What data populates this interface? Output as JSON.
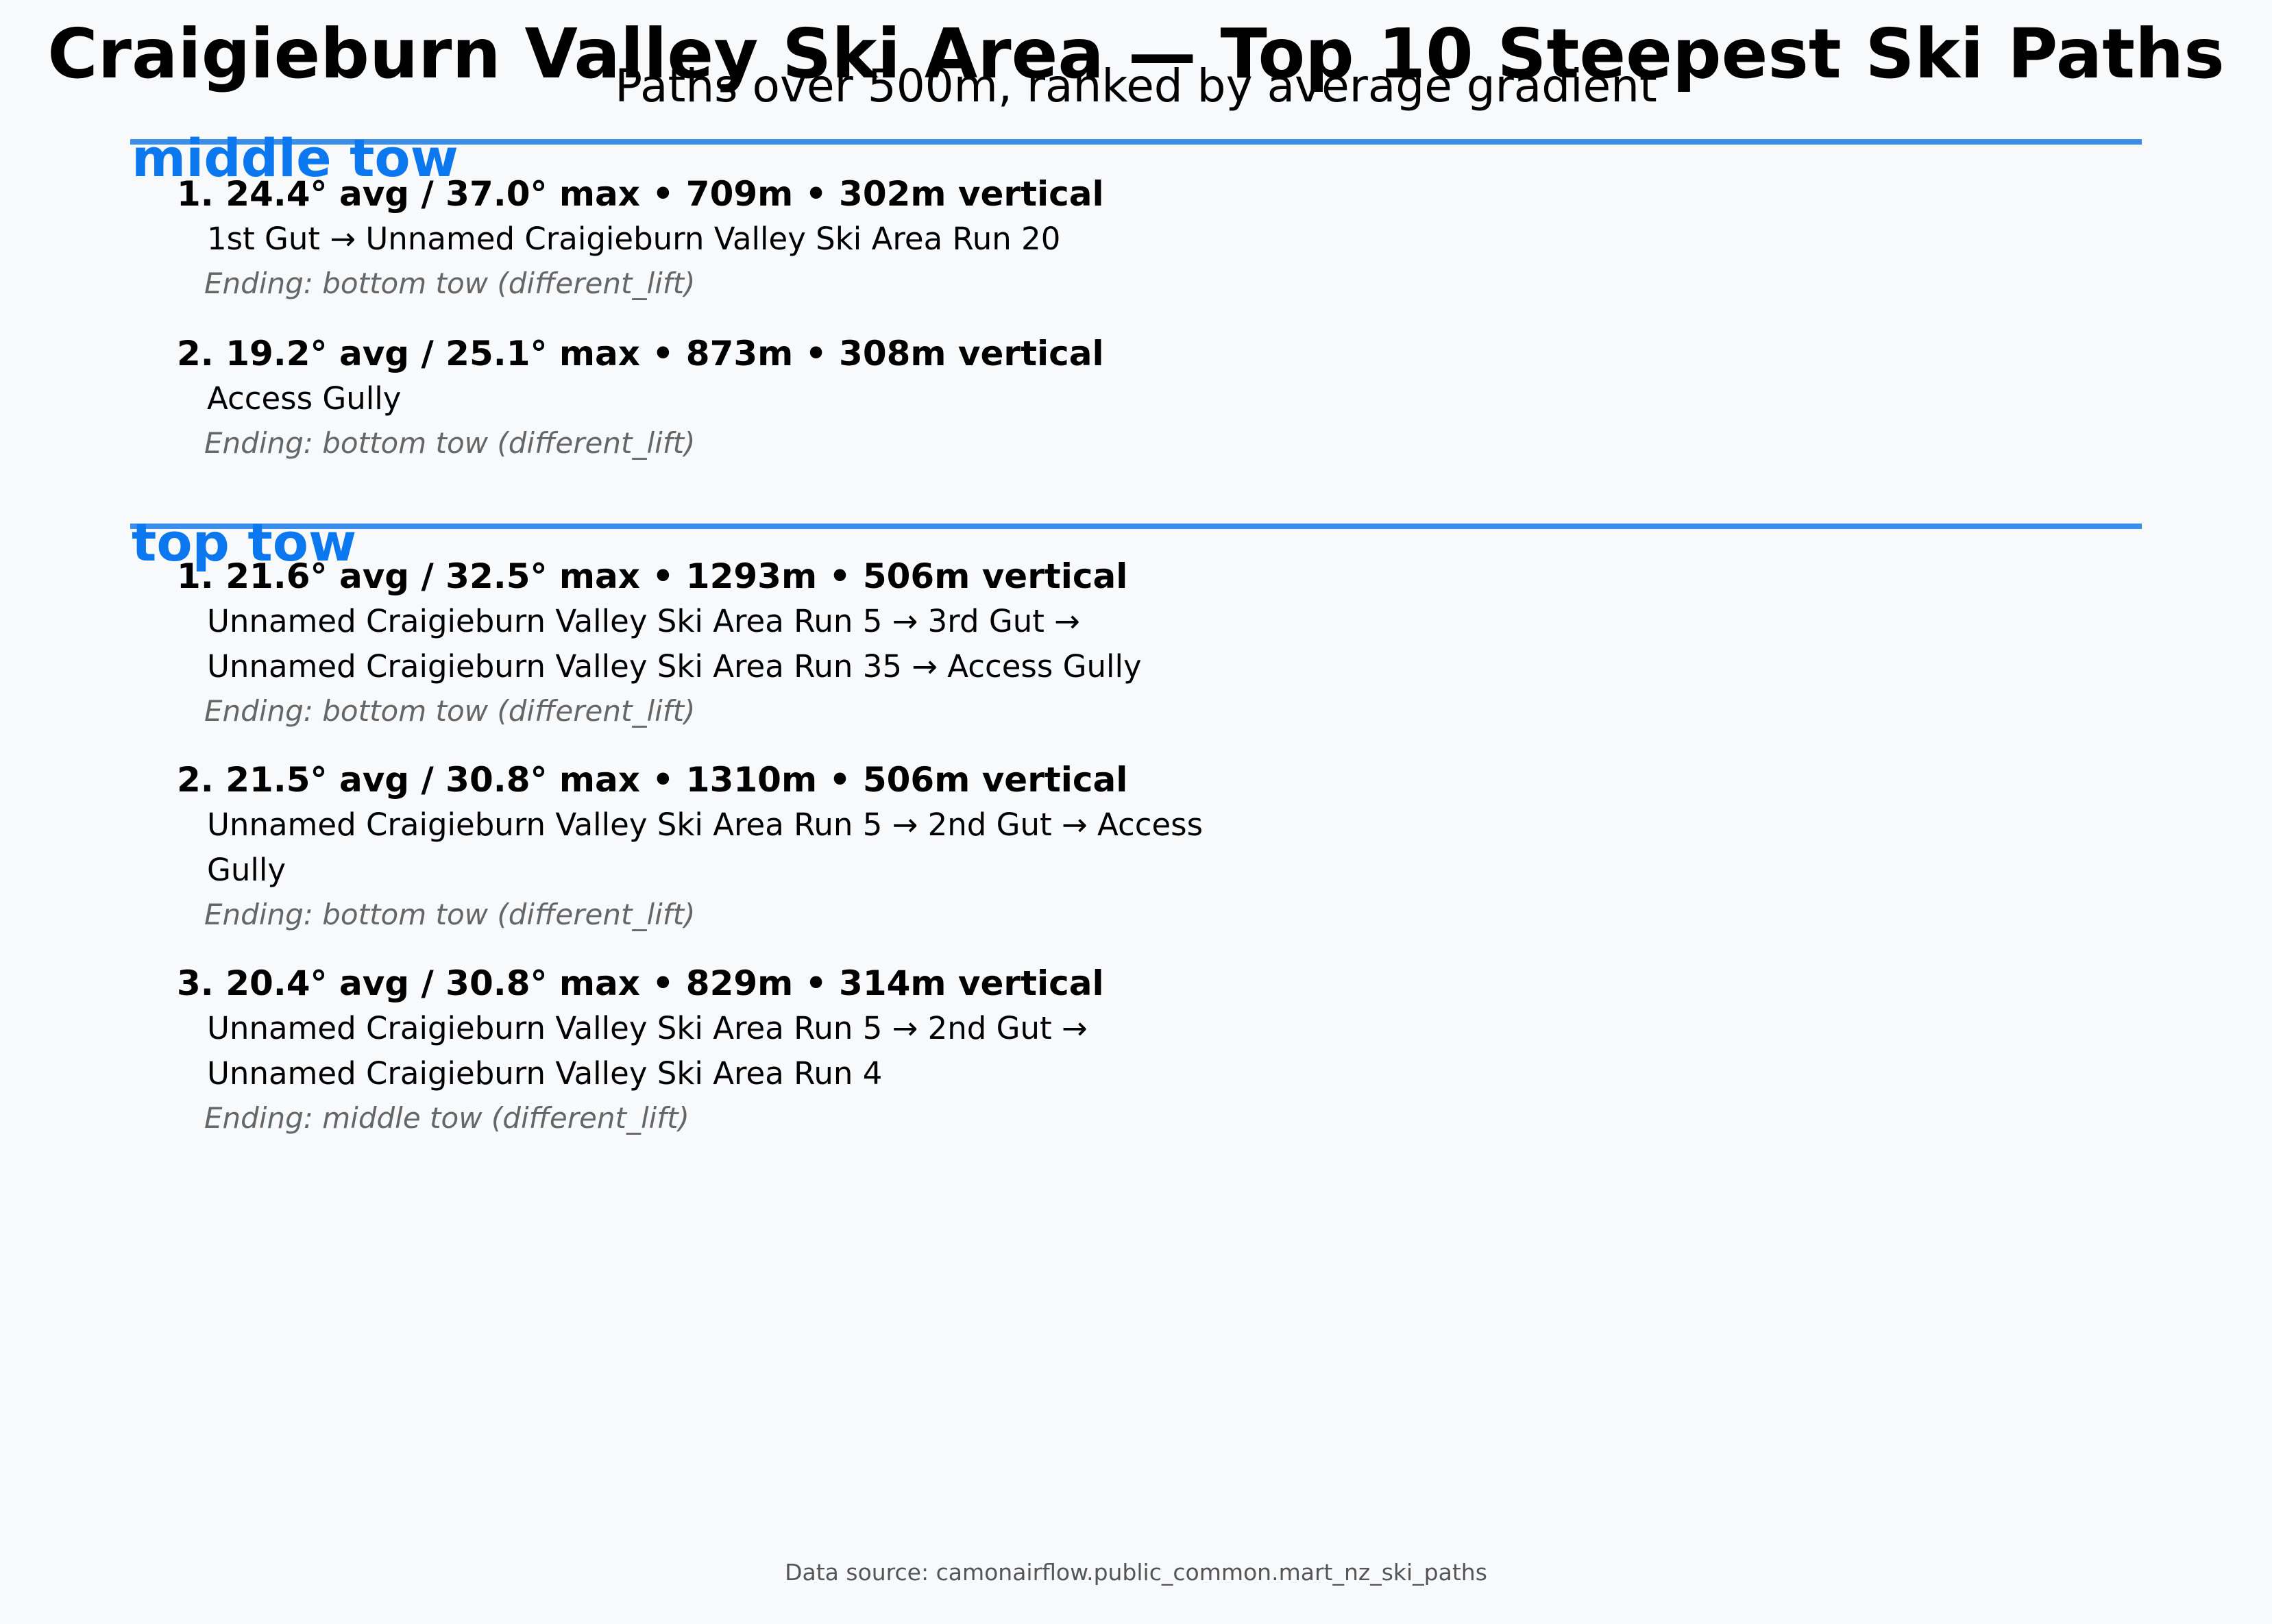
{
  "header": {
    "title": "Craigieburn Valley Ski Area — Top 10 Steepest Ski Paths",
    "subtitle": "Paths over 500m, ranked by average gradient"
  },
  "sections": [
    {
      "name": "middle tow",
      "entries": [
        {
          "headline": "1. 24.4° avg / 37.0° max • 709m • 302m vertical",
          "path_lines": [
            "1st Gut → Unnamed Craigieburn Valley Ski Area Run 20"
          ],
          "ending": "Ending: bottom tow (different_lift)"
        },
        {
          "headline": "2. 19.2° avg / 25.1° max • 873m • 308m vertical",
          "path_lines": [
            "Access Gully"
          ],
          "ending": "Ending: bottom tow (different_lift)"
        }
      ]
    },
    {
      "name": "top tow",
      "entries": [
        {
          "headline": "1. 21.6° avg / 32.5° max • 1293m • 506m vertical",
          "path_lines": [
            "Unnamed Craigieburn Valley Ski Area Run 5 → 3rd Gut →",
            "Unnamed Craigieburn Valley Ski Area Run 35 → Access Gully"
          ],
          "ending": "Ending: bottom tow (different_lift)"
        },
        {
          "headline": "2. 21.5° avg / 30.8° max • 1310m • 506m vertical",
          "path_lines": [
            "Unnamed Craigieburn Valley Ski Area Run 5 → 2nd Gut → Access",
            "Gully"
          ],
          "ending": "Ending: bottom tow (different_lift)"
        },
        {
          "headline": "3. 20.4° avg / 30.8° max • 829m • 314m vertical",
          "path_lines": [
            "Unnamed Craigieburn Valley Ski Area Run 5 → 2nd Gut →",
            "Unnamed Craigieburn Valley Ski Area Run 4"
          ],
          "ending": "Ending: middle tow (different_lift)"
        }
      ]
    }
  ],
  "footer": {
    "source": "Data source: camonairflow.public_common.mart_nz_ski_paths"
  },
  "colors": {
    "accent": "#0b78f0",
    "rule": "#3b8fe9",
    "muted": "#666666",
    "background": "#f8f9fb"
  }
}
